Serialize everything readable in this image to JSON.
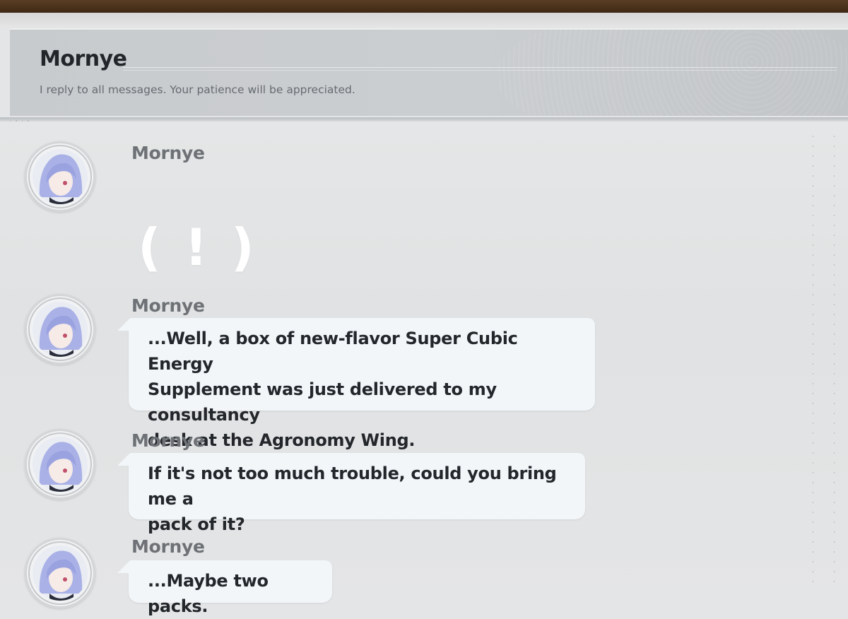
{
  "header": {
    "title": "Mornye",
    "subtitle": "I reply to all messages. Your patience will be appreciated."
  },
  "messages": [
    {
      "sender": "Mornye",
      "type": "sticker",
      "text": "( ! )"
    },
    {
      "sender": "Mornye",
      "type": "text",
      "lines": [
        "...Well, a box of new-flavor Super Cubic Energy",
        "Supplement was just delivered to my consultancy",
        "desk at the Agronomy Wing."
      ]
    },
    {
      "sender": "Mornye",
      "type": "text",
      "lines": [
        "If it's not too much trouble, could you bring me a",
        "pack of it?"
      ]
    },
    {
      "sender": "Mornye",
      "type": "text",
      "lines": [
        "...Maybe two packs."
      ]
    }
  ],
  "icons": {
    "avatar": "mornye-avatar-icon"
  },
  "colors": {
    "bubble": "#f3f6f9",
    "header_bg": "#c8cbce",
    "top_bar": "#4a3219"
  }
}
